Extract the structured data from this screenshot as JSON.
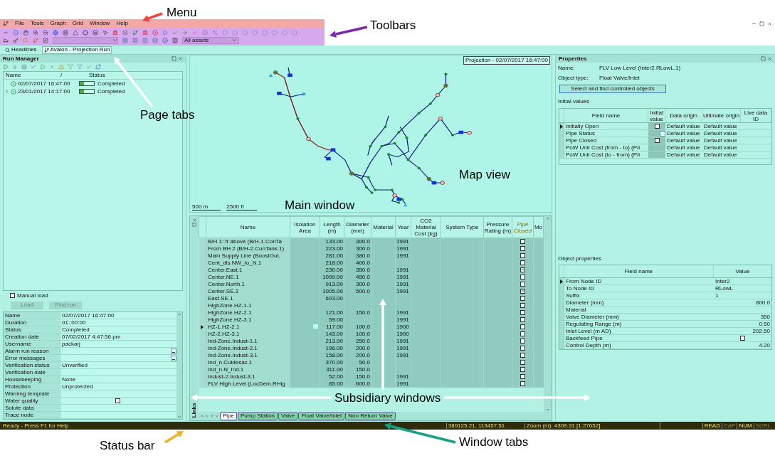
{
  "menu": [
    "File",
    "Tools",
    "Graph",
    "Grid",
    "Window",
    "Help"
  ],
  "toolbar": {
    "asset_filter": "All assets"
  },
  "page_tabs": [
    {
      "label": "Headlines",
      "selected": false
    },
    {
      "label": "Avalon - Projection Run",
      "selected": true
    }
  ],
  "run_manager": {
    "title": "Run Manager",
    "columns": [
      "Name",
      "/",
      "Status"
    ],
    "runs": [
      {
        "date": "02/07/2017 16:47:00",
        "status": "Completed"
      },
      {
        "date": "23/01/2017 14:17:00",
        "status": "Completed",
        "expanded": false
      }
    ],
    "manual_load": {
      "label": "Manual load",
      "checked": false
    },
    "buttons": [
      {
        "label": "Load",
        "disabled": true
      },
      {
        "label": "Find run",
        "disabled": true
      }
    ],
    "properties": [
      {
        "name": "Name",
        "kind": "text",
        "value": "02/07/2017 16:47:00"
      },
      {
        "name": "Duration",
        "kind": "text",
        "value": "01::00:00"
      },
      {
        "name": "Status",
        "kind": "text",
        "value": "Completed"
      },
      {
        "name": "Creation date",
        "kind": "text",
        "value": "07/02/2017 4:47:56 pm"
      },
      {
        "name": "Username",
        "kind": "text",
        "value": "packarj"
      },
      {
        "name": "Alarm run reason",
        "kind": "ellipsis"
      },
      {
        "name": "Error messages",
        "kind": "ellipsis"
      },
      {
        "name": "Verification status",
        "kind": "text",
        "value": "Unverified"
      },
      {
        "name": "Verification date",
        "kind": "text"
      },
      {
        "name": "Housekeeping",
        "kind": "text",
        "value": "None"
      },
      {
        "name": "Protection",
        "kind": "text",
        "value": "Unprotected"
      },
      {
        "name": "Warning template",
        "kind": "text"
      },
      {
        "name": "Water quality",
        "kind": "checkbox",
        "checked": false
      },
      {
        "name": "Solute data",
        "kind": "text"
      },
      {
        "name": "Trace node",
        "kind": "text"
      }
    ]
  },
  "map": {
    "title": "Projection - 02/07/2017 16:47:00",
    "scale": [
      "500 m",
      "2500 ft"
    ]
  },
  "grid": {
    "side_label": "Links",
    "columns": [
      {
        "label": "Name",
        "kind": "text"
      },
      {
        "label": "Isolation Area",
        "kind": "text"
      },
      {
        "label": "Length (m)",
        "kind": "number"
      },
      {
        "label": "Diameter (mm)",
        "kind": "number"
      },
      {
        "label": "Material",
        "kind": "text"
      },
      {
        "label": "Year",
        "kind": "text"
      },
      {
        "label": "CO2 Material Cost (kg)",
        "kind": "number"
      },
      {
        "label": "System Type",
        "kind": "text"
      },
      {
        "label": "Pressure Rating (m)",
        "kind": "number"
      },
      {
        "label": "Pipe Closed",
        "kind": "checkbox"
      },
      {
        "label": "Mo",
        "kind": "text"
      }
    ],
    "rows": [
      {
        "name": "B/H 1: fr above (B/H-1.ConTa",
        "length": "133.00",
        "diameter": "300.0",
        "year": "1991",
        "pipe_closed": false,
        "selected": false
      },
      {
        "name": "From BH 2 (B/H-2.ConTank.1)",
        "length": "223.00",
        "diameter": "300.0",
        "year": "1991",
        "pipe_closed": false,
        "selected": false
      },
      {
        "name": "Main Supply Line (BoostOut.",
        "length": "281.00",
        "diameter": "380.0",
        "year": "1991",
        "pipe_closed": false,
        "selected": false
      },
      {
        "name": "Cent_dis.NW_to_N.1",
        "length": "218.00",
        "diameter": "400.0",
        "pipe_closed": false,
        "selected": false
      },
      {
        "name": "Center.East.1",
        "length": "230.00",
        "diameter": "350.0",
        "year": "1991",
        "pipe_closed": true,
        "selected": false
      },
      {
        "name": "Center.NE.1",
        "length": "1099.00",
        "diameter": "450.0",
        "year": "1991",
        "pipe_closed": false,
        "selected": false
      },
      {
        "name": "Center.North.1",
        "length": "913.00",
        "diameter": "300.0",
        "year": "1991",
        "pipe_closed": false,
        "selected": false
      },
      {
        "name": "Center.SE.1",
        "length": "1005.00",
        "diameter": "500.0",
        "year": "1991",
        "pipe_closed": true,
        "selected": false
      },
      {
        "name": "East.SE.1",
        "length": "603.00",
        "pipe_closed": false,
        "selected": false
      },
      {
        "name": "HighZone.HZ-1.1",
        "pipe_closed": false,
        "selected": false
      },
      {
        "name": "HighZone.HZ-2.1",
        "length": "121.00",
        "diameter": "150.0",
        "year": "1991",
        "pipe_closed": false,
        "selected": false
      },
      {
        "name": "HighZone.HZ-3.1",
        "length": "59.00",
        "year": "1991",
        "pipe_closed": false,
        "selected": false
      },
      {
        "name": "HZ-1.HZ-2.1",
        "length": "117.00",
        "diameter": "100.0",
        "year": "1900",
        "pipe_closed": false,
        "selected": true
      },
      {
        "name": "HZ-2.HZ-3.1",
        "length": "143.00",
        "diameter": "100.0",
        "year": "1900",
        "pipe_closed": false,
        "selected": false
      },
      {
        "name": "Ind-Zone.Indust-1.1",
        "length": "213.00",
        "diameter": "250.0",
        "year": "1991",
        "pipe_closed": false,
        "selected": false
      },
      {
        "name": "Ind-Zone.Indust-2.1",
        "length": "196.00",
        "diameter": "200.0",
        "year": "1991",
        "pipe_closed": false,
        "selected": false
      },
      {
        "name": "Ind-Zone.Indust-3.1",
        "length": "158.00",
        "diameter": "200.0",
        "year": "1991",
        "pipe_closed": false,
        "selected": false
      },
      {
        "name": "Ind_n.Culdesac.1",
        "length": "370.00",
        "diameter": "50.0",
        "pipe_closed": false,
        "selected": false
      },
      {
        "name": "Ind_n.N_Ind.1",
        "length": "311.00",
        "diameter": "150.0",
        "pipe_closed": false,
        "selected": false
      },
      {
        "name": "Indust-2.Indust-3.1",
        "length": "52.00",
        "diameter": "150.0",
        "year": "1991",
        "pipe_closed": false,
        "selected": false
      },
      {
        "name": "FLV High Level (LocDem.RHig",
        "length": "85.00",
        "diameter": "600.0",
        "year": "1991",
        "pipe_closed": false,
        "selected": false
      }
    ],
    "tabs": [
      {
        "label": "Pipe",
        "selected": true
      },
      {
        "label": "Pump Station",
        "selected": false
      },
      {
        "label": "Valve",
        "selected": false
      },
      {
        "label": "Float Valve/Inlet",
        "selected": false
      },
      {
        "label": "Non Return Valve",
        "selected": false
      }
    ]
  },
  "properties": {
    "title": "Properties",
    "name_label": "Name:",
    "name": "FLV Low Level (Inter2.RLowL.1)",
    "type_label": "Object type:",
    "type": "Float Valve/Inlet",
    "button": "Select and find controlled objects",
    "initial_values": {
      "title": "Initial values",
      "columns": [
        "Field name",
        "Initial value",
        "Data origin",
        "Ultimate origin",
        "Live data ID"
      ],
      "rows": [
        {
          "field": "Initially Open",
          "kind": "checkbox",
          "checked": false,
          "data_origin": "Default value",
          "ultimate_origin": "Default value",
          "selected": true
        },
        {
          "field": "Pipe Status",
          "kind": "ellipsis",
          "data_origin": "Default value",
          "ultimate_origin": "Default value",
          "selected": false
        },
        {
          "field": "Pipe Closed",
          "kind": "checkbox",
          "checked": false,
          "data_origin": "Default value",
          "ultimate_origin": "Default value",
          "selected": false
        },
        {
          "field": "PoW Unit Cost (from - to) (P/i",
          "kind": "text",
          "data_origin": "Default value",
          "ultimate_origin": "Default value",
          "selected": false
        },
        {
          "field": "PoW Unit Cost (to - from) (P/i",
          "kind": "text",
          "data_origin": "Default value",
          "ultimate_origin": "Default value",
          "selected": false
        }
      ]
    },
    "object_properties": {
      "title": "Object properties",
      "columns": [
        "Field name",
        "Value"
      ],
      "rows": [
        {
          "field": "From Node ID",
          "kind": "text",
          "value": "Inter2",
          "selected": true
        },
        {
          "field": "To Node ID",
          "kind": "text",
          "value": "RLowL",
          "selected": false
        },
        {
          "field": "Suffix",
          "kind": "text",
          "value": "1",
          "selected": false
        },
        {
          "field": "Diameter (mm)",
          "kind": "number",
          "value": "800.0",
          "selected": false
        },
        {
          "field": "Material",
          "kind": "text",
          "selected": false
        },
        {
          "field": "Valve Diameter (mm)",
          "kind": "number",
          "value": "350",
          "selected": false
        },
        {
          "field": "Regulating Range (m)",
          "kind": "number",
          "value": "0.50",
          "selected": false
        },
        {
          "field": "Inlet Level (m AD)",
          "kind": "number",
          "value": "202.50",
          "selected": false
        },
        {
          "field": "Backfeed Pipe",
          "kind": "checkbox",
          "checked": false,
          "selected": false
        },
        {
          "field": "Control Depth (m)",
          "kind": "number",
          "value": "4.20",
          "selected": false
        }
      ]
    }
  },
  "status_bar": {
    "message": "Ready - Press F1 for Help",
    "coordinates": "389125.21, 113457.51",
    "zoom": "Zoom (m): 4309.31 [1:27652]",
    "indicators": [
      {
        "label": "READ",
        "on": true
      },
      {
        "label": "CAP",
        "on": false
      },
      {
        "label": "NUM",
        "on": true
      },
      {
        "label": "SCRL",
        "on": false
      }
    ]
  },
  "annotations": [
    "Menu",
    "Toolbars",
    "Page tabs",
    "Map view",
    "Main window",
    "Subsidiary windows",
    "Status bar",
    "Window tabs"
  ]
}
